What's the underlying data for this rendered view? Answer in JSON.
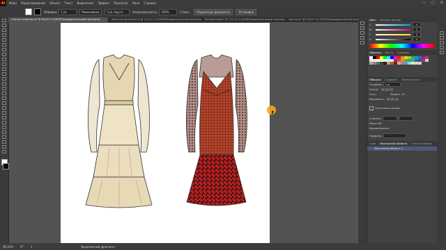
{
  "app": {
    "logo": "Ai"
  },
  "menu": [
    "Файл",
    "Редактирование",
    "Объект",
    "Текст",
    "Выделение",
    "Эффект",
    "Просмотр",
    "Окно",
    "Справка"
  ],
  "window_controls": [
    "—",
    "▢",
    "✕"
  ],
  "control_bar": {
    "fill_label": "",
    "stroke_label": "Обводка:",
    "stroke_value": "1 pt",
    "brush_value": "Равномерно",
    "style_value": "5 pt. Кругл.",
    "style_label": "5 pt. Кругл...",
    "opacity_label": "Непрозрачность:",
    "opacity_value": "100%",
    "style2_label": "Стиль:",
    "doc_settings": "Параметры документа",
    "prefs": "Установки"
  },
  "tabs": [
    "платье штрихом.ai* @ 96,24 % (CMYK/Предварительный просмотр)",
    "Женская футболка.ai @ 174,31 % (RGB/Предварительный просмотр)",
    "Безымянный-1 @ 174,31 % (RGB/Предварительный просмотр)",
    "свитер.ai* @ 156,07 % (CMYK/Предварительный просмотр)"
  ],
  "status": {
    "zoom": "96,24%",
    "rotation": "0°",
    "artboard": "1",
    "mode": "Выделенный фрагмент"
  },
  "panel": {
    "color_tabs": [
      "Цвет",
      "Каталог цветов"
    ],
    "color_rows": [
      {
        "k": "C",
        "v": "0"
      },
      {
        "k": "M",
        "v": "0"
      },
      {
        "k": "Y",
        "v": "0"
      },
      {
        "k": "K",
        "v": "0"
      }
    ],
    "swatch_tabs": [
      "Образцы",
      "Кисти",
      "Символы"
    ],
    "stroke_tabs": [
      "Обводка",
      "Градиент",
      "Прозрачность"
    ],
    "stroke_fields": [
      {
        "label": "Толщина:",
        "value": "1 pt"
      },
      {
        "label": "Концы:",
        "value": ""
      },
      {
        "label": "Угол:",
        "value": "Предел:  10"
      },
      {
        "label": "Выровнять:",
        "value": ""
      }
    ],
    "dashed": "Пунктирная линия",
    "arrows_label": "Стрелки:",
    "scale_label": "Масштаб:",
    "align_label": "Выравнивание:",
    "profile_label": "Профиль:",
    "layer_tabs": [
      "Слои",
      "Монтажные области",
      "Стили графики"
    ],
    "layer_name": "Монтажная область 1"
  },
  "colors": {
    "accent": "#f3a41c",
    "dress_left_fill": "#eadfc3",
    "dress_right_fill": "#b6462d",
    "hem_right": "#b11f1f"
  }
}
